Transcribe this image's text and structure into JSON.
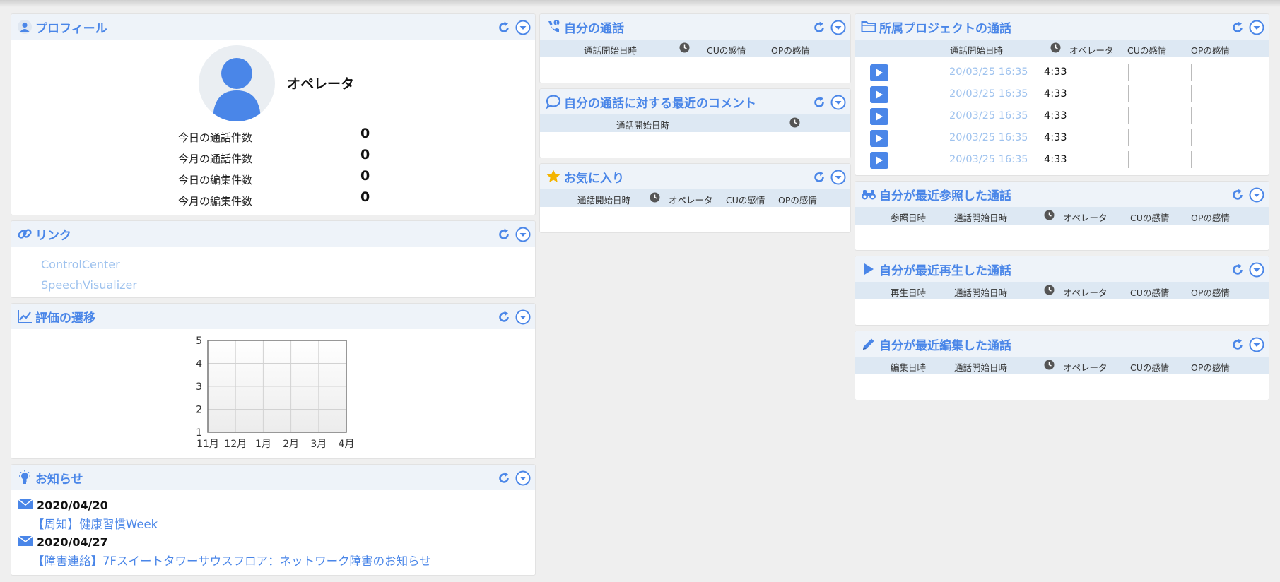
{
  "profile": {
    "title": "プロフィール",
    "name": "オペレータ",
    "stats": [
      {
        "label": "今日の通話件数",
        "value": "0"
      },
      {
        "label": "今月の通話件数",
        "value": "0"
      },
      {
        "label": "今日の編集件数",
        "value": "0"
      },
      {
        "label": "今月の編集件数",
        "value": "0"
      }
    ]
  },
  "links": {
    "title": "リンク",
    "items": [
      "ControlCenter",
      "SpeechVisualizer"
    ]
  },
  "evaluation": {
    "title": "評価の遷移"
  },
  "notices": {
    "title": "お知らせ",
    "items": [
      {
        "date": "2020/04/20",
        "text": "【周知】健康習慣Week"
      },
      {
        "date": "2020/04/27",
        "text": "【障害連絡】7Fスイートタワーサウスフロア：ネットワーク障害のお知らせ"
      }
    ]
  },
  "my_calls": {
    "title": "自分の通話",
    "columns": [
      "通話開始日時",
      "CUの感情",
      "OPの感情"
    ]
  },
  "recent_comments": {
    "title": "自分の通話に対する最近のコメント",
    "columns": [
      "通話開始日時"
    ]
  },
  "favorites": {
    "title": "お気に入り",
    "columns": [
      "通話開始日時",
      "オペレータ",
      "CUの感情",
      "OPの感情"
    ]
  },
  "project_calls": {
    "title": "所属プロジェクトの通話",
    "columns": [
      "通話開始日時",
      "オペレータ",
      "CUの感情",
      "OPの感情"
    ],
    "rows": [
      {
        "date": "20/03/25 16:35",
        "duration": "4:33"
      },
      {
        "date": "20/03/25 16:35",
        "duration": "4:33"
      },
      {
        "date": "20/03/25 16:35",
        "duration": "4:33"
      },
      {
        "date": "20/03/25 16:35",
        "duration": "4:33"
      },
      {
        "date": "20/03/25 16:35",
        "duration": "4:33"
      }
    ]
  },
  "recently_viewed": {
    "title": "自分が最近参照した通話",
    "columns": [
      "参照日時",
      "通話開始日時",
      "オペレータ",
      "CUの感情",
      "OPの感情"
    ]
  },
  "recently_played": {
    "title": "自分が最近再生した通話",
    "columns": [
      "再生日時",
      "通話開始日時",
      "オペレータ",
      "CUの感情",
      "OPの感情"
    ]
  },
  "recently_edited": {
    "title": "自分が最近編集した通話",
    "columns": [
      "編集日時",
      "通話開始日時",
      "オペレータ",
      "CUの感情",
      "OPの感情"
    ]
  },
  "chart_data": {
    "type": "line",
    "categories": [
      "11月",
      "12月",
      "1月",
      "2月",
      "3月",
      "4月"
    ],
    "series": [],
    "ylim": [
      1,
      5
    ],
    "yticks": [
      1,
      2,
      3,
      4,
      5
    ],
    "grid": true
  },
  "colors": {
    "accent": "#4a86e8",
    "link": "#9ec2ee",
    "header_bg": "#eef3f9",
    "table_header_bg": "#dde8f3",
    "star": "#f4b400"
  }
}
